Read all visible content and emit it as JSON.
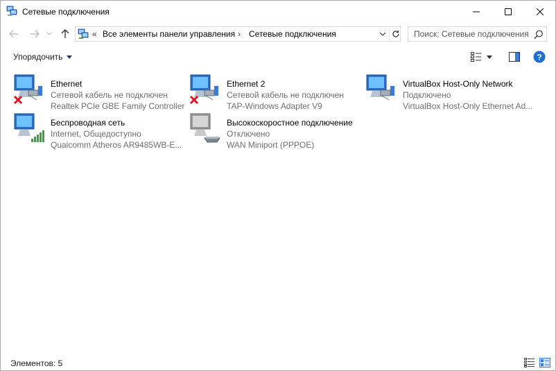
{
  "window": {
    "title": "Сетевые подключения",
    "icon": "network-connections-icon"
  },
  "navigation": {
    "breadcrumb_overflow": "«",
    "breadcrumbs": [
      "Все элементы панели управления",
      "Сетевые подключения"
    ],
    "separator": "›",
    "search_placeholder": "Поиск: Сетевые подключения"
  },
  "toolbar": {
    "organize_label": "Упорядочить"
  },
  "connections": [
    {
      "name": "Ethernet",
      "status": "Сетевой кабель не подключен",
      "device": "Realtek PCIe GBE Family Controller",
      "state": "disconnected",
      "badge": "red-x"
    },
    {
      "name": "Ethernet 2",
      "status": "Сетевой кабель не подключен",
      "device": "TAP-Windows Adapter V9",
      "state": "disconnected",
      "badge": "red-x"
    },
    {
      "name": "VirtualBox Host-Only Network",
      "status": "Подключено",
      "device": "VirtualBox Host-Only Ethernet Ad...",
      "state": "connected",
      "badge": "none"
    },
    {
      "name": "Беспроводная сеть",
      "status": "Internet, Общедоступно",
      "device": "Qualcomm Atheros AR9485WB-E...",
      "state": "wireless",
      "badge": "signal-bars"
    },
    {
      "name": "Высокоскоростное подключение",
      "status": "Отключено",
      "device": "WAN Miniport (PPPOE)",
      "state": "disabled",
      "badge": "modem"
    }
  ],
  "statusbar": {
    "count_label": "Элементов: 5"
  },
  "colors": {
    "accent": "#0078d7",
    "help": "#1c6fd0",
    "error_x": "#e81123",
    "signal": "#36a63a",
    "muted_text": "#6d6d6d"
  }
}
